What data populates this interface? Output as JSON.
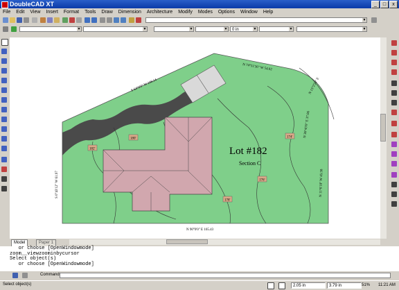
{
  "window": {
    "title": "DoubleCAD XT",
    "min": "_",
    "max": "□",
    "close": "x"
  },
  "menu": [
    "File",
    "Edit",
    "View",
    "Insert",
    "Format",
    "Tools",
    "Draw",
    "Dimension",
    "Architecture",
    "Modify",
    "Modes",
    "Options",
    "Window",
    "Help"
  ],
  "toolbar": {
    "unit_value": "0 in"
  },
  "drawing": {
    "lot_title": "Lot #182",
    "section": "Section C",
    "bearings": {
      "top_long": "N 74°51'36\" W  54.02",
      "top_left": "S 64°0'0\" W  108.14",
      "arc": "N 15°2'24\" E",
      "right_upper": "N 36°45'0\" E  37.06",
      "right_lower": "N 11°6'18\" W  45.58",
      "left": "S 0°43'12\" W  61.97",
      "bottom": "N 90°0'0\" E  165.43"
    },
    "elevations": [
      "182'",
      "180'",
      "178'",
      "176'",
      "174'"
    ]
  },
  "tabs": {
    "model": "Model",
    "paper": "Paper 1"
  },
  "command_history": [
    "   or choose [OpenWindowmode]",
    "zoom__viewzoominbycursor",
    "Select object(s)",
    "   or choose [OpenWindowmode]"
  ],
  "command_label": "Command:",
  "status": {
    "message": "Select object(s)",
    "x_coord": "2.05 in",
    "y_coord": "3.79 in",
    "zoom": "51%",
    "time": "11:21 AM"
  },
  "colors": {
    "lawn": "#7fcf8a",
    "road": "#4a4a4a",
    "roof": "#d1a7ae",
    "tag": "#d8a988",
    "titlebar": "#0a3aa8"
  }
}
